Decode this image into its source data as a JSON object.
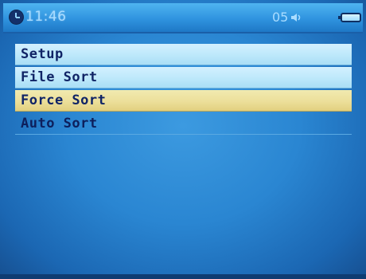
{
  "status_bar": {
    "time": "11:46",
    "volume": "05",
    "icons": {
      "clock": "clock-icon",
      "speaker": "speaker-icon",
      "battery": "battery-icon"
    }
  },
  "menu": {
    "items": [
      {
        "label": "Setup",
        "state": "normal"
      },
      {
        "label": "File Sort",
        "state": "normal"
      },
      {
        "label": "Force Sort",
        "state": "selected"
      },
      {
        "label": "Auto Sort",
        "state": "normal"
      }
    ]
  },
  "colors": {
    "background": "#2a86d2",
    "item_background": "#c2eafb",
    "selected_background": "#ecdf9a",
    "text": "#102466"
  }
}
